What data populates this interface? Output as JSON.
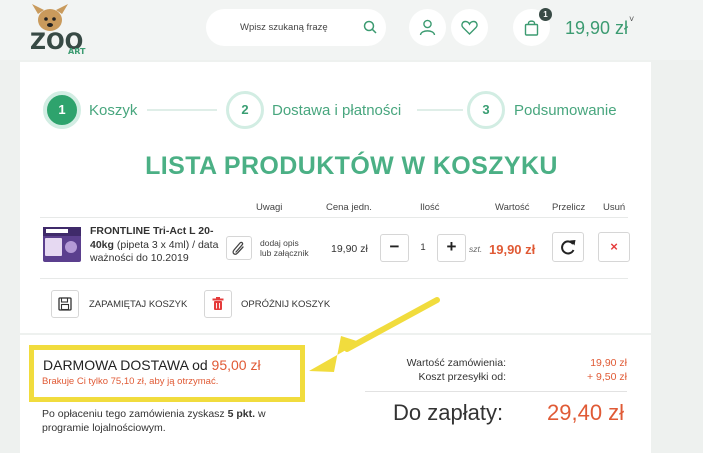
{
  "header": {
    "logo_text": "ZOO ART",
    "search_placeholder": "Wpisz szukaną frazę",
    "cart_badge": "1",
    "cart_total": "19,90 zł"
  },
  "steps": [
    {
      "number": "1",
      "label": "Koszyk",
      "active": true
    },
    {
      "number": "2",
      "label": "Dostawa i płatności",
      "active": false
    },
    {
      "number": "3",
      "label": "Podsumowanie",
      "active": false
    }
  ],
  "heading": "LISTA PRODUKTÓW W KOSZYKU",
  "table_headers": {
    "notes": "Uwagi",
    "unit_price": "Cena jedn.",
    "quantity": "Ilość",
    "value": "Wartość",
    "recalculate": "Przelicz",
    "remove": "Usuń"
  },
  "cart_item": {
    "name_bold": "FRONTLINE Tri-Act L 20-40kg",
    "name_rest": " (pipeta 3 x 4ml) / data ważności do 10.2019",
    "note_link": "dodaj opis lub załącznik",
    "unit_price": "19,90 zł",
    "quantity": "1",
    "unit": "szt.",
    "value": "19,90 zł",
    "remove_symbol": "×",
    "minus_symbol": "−",
    "plus_symbol": "+"
  },
  "actions": {
    "save_cart": "ZAPAMIĘTAJ KOSZYK",
    "clear_cart": "OPRÓŻNIJ KOSZYK"
  },
  "free_shipping": {
    "title": "DARMOWA DOSTAWA od ",
    "amount": "95,00 zł",
    "missing": "Brakuje Ci tylko 75,10 zł, aby ją otrzymać."
  },
  "loyalty": {
    "prefix": "Po opłaceniu tego zamówienia zyskasz ",
    "points": "5 pkt.",
    "suffix": " w programie lojalnościowym."
  },
  "summary": {
    "order_value_label": "Wartość zamówienia:",
    "order_value": "19,90 zł",
    "shipping_label": "Koszt przesyłki od:",
    "shipping_value": "+ 9,50 zł",
    "total_label": "Do zapłaty:",
    "total_value": "29,40 zł"
  },
  "colors": {
    "accent_green": "#2ea36d",
    "price_orange": "#e05a35",
    "highlight_yellow": "#f1dc3d"
  }
}
